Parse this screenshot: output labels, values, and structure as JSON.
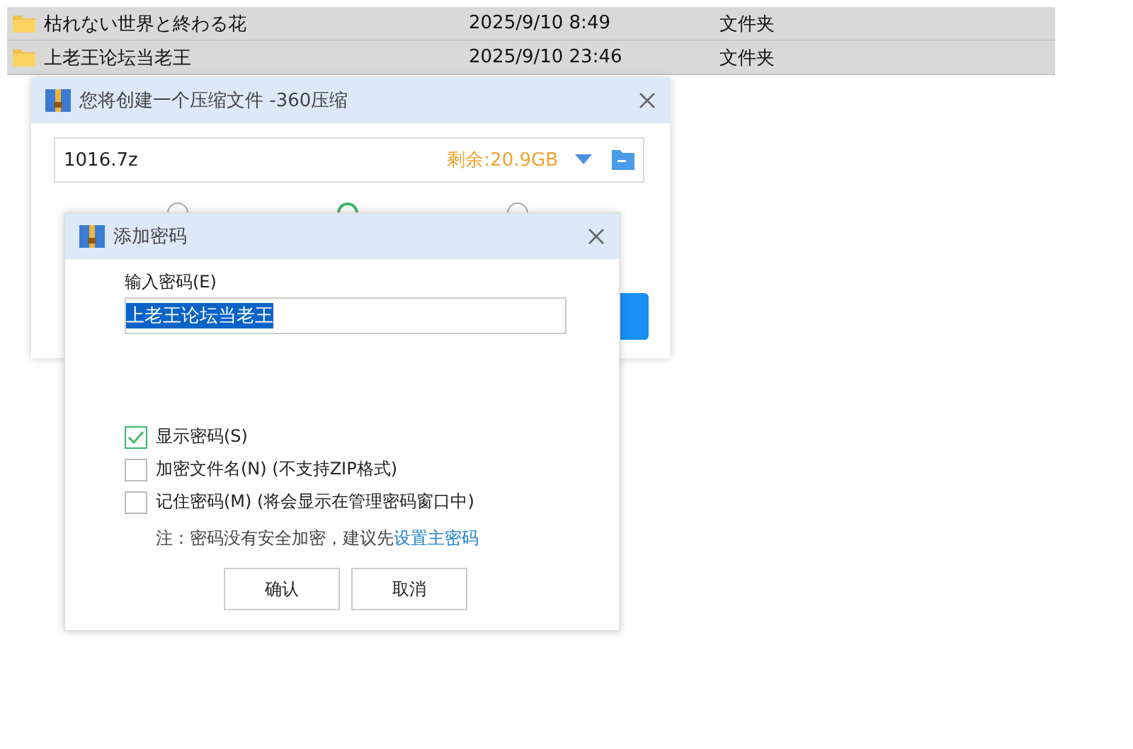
{
  "file_list": {
    "rows": [
      {
        "name": "枯れない世界と終わる花",
        "date": "2025/9/10 8:49",
        "type": "文件夹"
      },
      {
        "name": "上老王论坛当老王",
        "date": "2025/9/10 23:46",
        "type": "文件夹"
      }
    ]
  },
  "compress_dialog": {
    "title": "您将创建一个压缩文件 -360压缩",
    "filename": "1016.7z",
    "free_space": "剩余:20.9GB",
    "options": [
      {
        "selected": false
      },
      {
        "selected": true
      },
      {
        "selected": false
      }
    ]
  },
  "password_dialog": {
    "title": "添加密码",
    "label": "输入密码(E)",
    "value": "上老王论坛当老王",
    "checkboxes": [
      {
        "label": "显示密码(S)",
        "checked": true
      },
      {
        "label": "加密文件名(N) (不支持ZIP格式)",
        "checked": false
      },
      {
        "label": "记住密码(M) (将会显示在管理密码窗口中)",
        "checked": false
      }
    ],
    "note": "注：密码没有安全加密，建议先",
    "note_link": "设置主密码",
    "buttons": [
      "确认",
      "取消"
    ]
  }
}
